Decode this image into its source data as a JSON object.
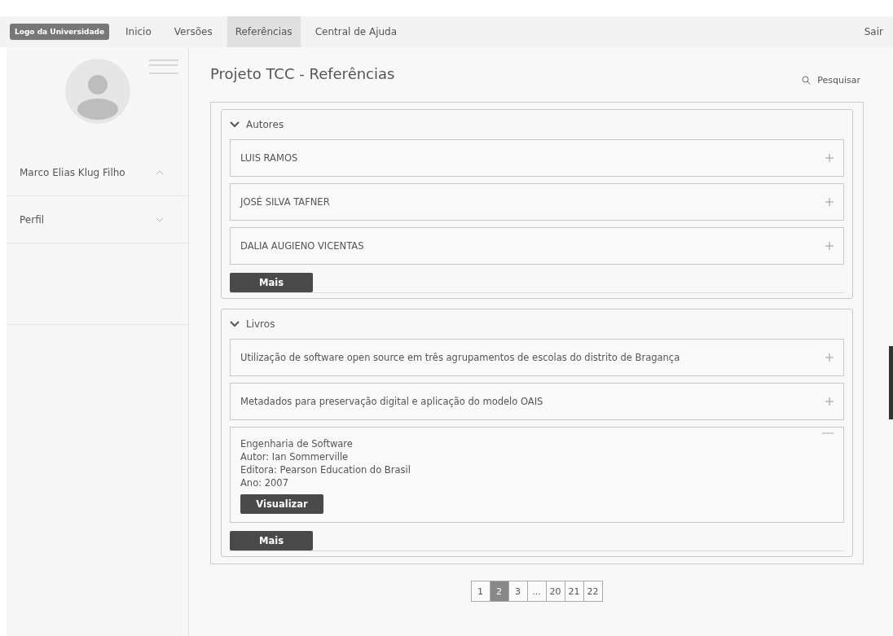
{
  "navbar": {
    "logo": "Logo da Universidade",
    "items": [
      {
        "label": "Inicio",
        "selected": false
      },
      {
        "label": "Versões",
        "selected": false
      },
      {
        "label": "Referências",
        "selected": true
      },
      {
        "label": "Central de Ajuda",
        "selected": false
      }
    ],
    "logout": "Sair"
  },
  "sidebar": {
    "items": [
      {
        "label": "Marco Elias Klug Filho",
        "expanded": true
      },
      {
        "label": "Perfil",
        "expanded": false
      }
    ]
  },
  "page": {
    "title": "Projeto TCC - Referências",
    "search": "Pesquisar"
  },
  "sections": [
    {
      "title": "Autores",
      "expanded": true,
      "more": "Mais",
      "items": [
        {
          "title": "LUIS RAMOS",
          "expanded": false
        },
        {
          "title": "JOSÉ SILVA TAFNER",
          "expanded": false
        },
        {
          "title": "DALIA AUGIENO VICENTAS",
          "expanded": false
        }
      ]
    },
    {
      "title": "Livros",
      "expanded": true,
      "more": "Mais",
      "items": [
        {
          "title": "Utilização de software open source em três agrupamentos de escolas do distrito de Bragança",
          "expanded": false
        },
        {
          "title": "Metadados para preservação digital e aplicação do modelo OAIS",
          "expanded": false
        },
        {
          "title": "Engenharia de Software",
          "expanded": true,
          "details": [
            "Autor: Ian Sommerville",
            "Editora: Pearson Education do Brasil",
            "Ano: 2007"
          ],
          "action": "Visualizar"
        }
      ]
    }
  ],
  "pagination": [
    {
      "label": "1",
      "selected": false
    },
    {
      "label": "2",
      "selected": true
    },
    {
      "label": "3",
      "selected": false
    },
    {
      "label": "...",
      "selected": false
    },
    {
      "label": "20",
      "selected": false
    },
    {
      "label": "21",
      "selected": false
    },
    {
      "label": "22",
      "selected": false
    }
  ]
}
